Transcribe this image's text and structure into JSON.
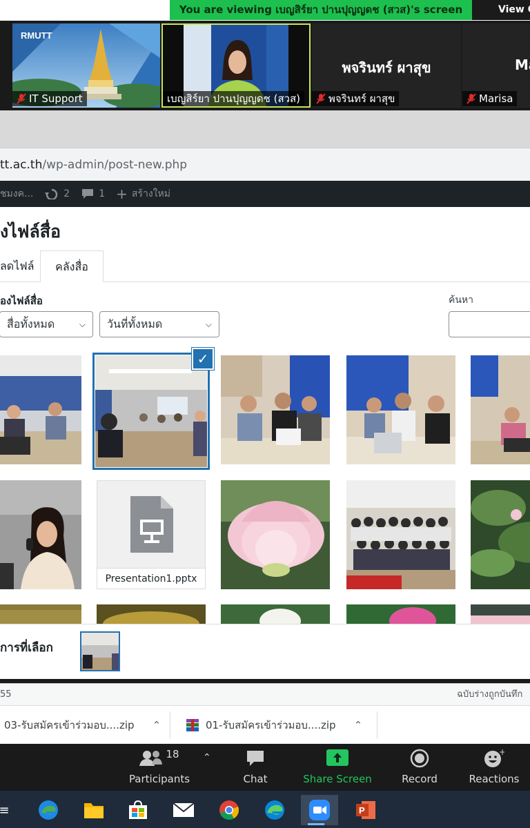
{
  "zoom": {
    "viewing_banner": "You are viewing เบญสิร์ยา ปานปุญญดช (สวส)'s screen",
    "view_options": "View O",
    "participants_strip": [
      {
        "name": "IT Support",
        "muted": true
      },
      {
        "name": "เบญสิร์ยา ปานปุญญดช (สวส)",
        "muted": false
      },
      {
        "name": "พจรินทร์ ผาสุข",
        "muted": true,
        "big_name": "พจรินทร์ ผาสุข"
      },
      {
        "name": "Marisa",
        "muted": true,
        "big_name": "Ma"
      }
    ],
    "toolbar": {
      "participants_label": "Participants",
      "participants_count": "18",
      "chat_label": "Chat",
      "share_label": "Share Screen",
      "record_label": "Record",
      "reactions_label": "Reactions"
    },
    "colors": {
      "banner": "#1dbf4e",
      "share_accent": "#22c55e"
    }
  },
  "browser": {
    "url_host": "tt.ac.th",
    "url_path": "/wp-admin/post-new.php",
    "downloads": [
      {
        "name": "03-รับสมัครเข้าร่วมอบ....zip"
      },
      {
        "name": "01-รับสมัครเข้าร่วมอบ....zip"
      }
    ]
  },
  "wp_adminbar": {
    "site": "ชมงค...",
    "updates_count": "2",
    "comments_count": "1",
    "new_label": "สร้างใหม่"
  },
  "media_modal": {
    "title": "งไฟล์สื่อ",
    "tabs": [
      {
        "label": "ลดไฟล์"
      },
      {
        "label": "คลังสื่อ",
        "active": true
      }
    ],
    "filter_label": "องไฟล์สื่อ",
    "filter_type": "สื่อทั้งหมด",
    "filter_date": "วันที่ทั้งหมด",
    "search_label": "ค้นหา",
    "attachments": [
      {
        "kind": "photo",
        "name": "meeting-room-1"
      },
      {
        "kind": "photo",
        "name": "meeting-room-2",
        "selected": true
      },
      {
        "kind": "photo",
        "name": "participants-1"
      },
      {
        "kind": "photo",
        "name": "participants-2"
      },
      {
        "kind": "photo",
        "name": "participants-3"
      },
      {
        "kind": "photo",
        "name": "speaker"
      },
      {
        "kind": "file",
        "name": "Presentation1.pptx"
      },
      {
        "kind": "photo",
        "name": "lotus-pink"
      },
      {
        "kind": "photo",
        "name": "group-photo"
      },
      {
        "kind": "photo",
        "name": "lotus-leaves"
      }
    ],
    "selection_label": "การที่เลือก"
  },
  "editor_status": {
    "word_count": "55",
    "draft_saved": "ฉบับร่างถูกบันทึก"
  }
}
